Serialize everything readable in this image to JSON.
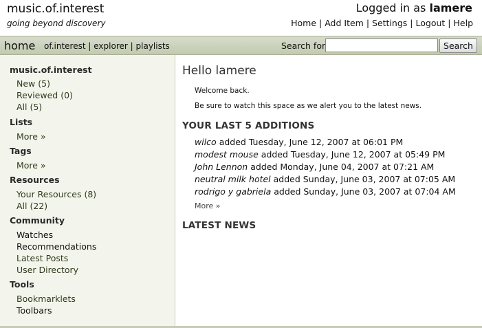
{
  "header": {
    "site_title": "music.of.interest",
    "tagline": "going beyond discovery",
    "login_prefix": "Logged in as",
    "username": "lamere",
    "nav": [
      "Home",
      "Add Item",
      "Settings",
      "Logout",
      "Help"
    ]
  },
  "navbar": {
    "home": "home",
    "links": [
      "of.interest",
      "explorer",
      "playlists"
    ],
    "search_label": "Search for",
    "search_value": "",
    "search_button": "Search"
  },
  "sidebar": {
    "sections": [
      {
        "title": "music.of.interest",
        "items": [
          "New (5)",
          "Reviewed (0)",
          "All (5)"
        ]
      },
      {
        "title": "Lists",
        "items": [
          "More »"
        ]
      },
      {
        "title": "Tags",
        "items": [
          "More »"
        ]
      },
      {
        "title": "Resources",
        "items": [
          "Your Resources (8)",
          "All (22)"
        ]
      },
      {
        "title": "Community",
        "items": [
          "Watches",
          "Recommendations",
          "Latest Posts",
          "User Directory"
        ]
      },
      {
        "title": "Tools",
        "items": [
          "Bookmarklets",
          "Toolbars"
        ]
      }
    ]
  },
  "main": {
    "greeting": "Hello lamere",
    "welcome": "Welcome back.",
    "notice": "Be sure to watch this space as we alert you to the latest news.",
    "additions_title": "YOUR LAST 5 ADDITIONS",
    "additions": [
      {
        "artist": "wilco",
        "text": "added Tuesday, June 12, 2007 at 06:01 PM"
      },
      {
        "artist": "modest mouse",
        "text": "added Tuesday, June 12, 2007 at 05:49 PM"
      },
      {
        "artist": "John Lennon",
        "text": "added Monday, June 04, 2007 at 07:21 AM"
      },
      {
        "artist": "neutral milk hotel",
        "text": "added Sunday, June 03, 2007 at 07:05 AM"
      },
      {
        "artist": "rodrigo y gabriela",
        "text": "added Sunday, June 03, 2007 at 07:04 AM"
      }
    ],
    "more_link": "More »",
    "news_title": "LATEST NEWS"
  }
}
